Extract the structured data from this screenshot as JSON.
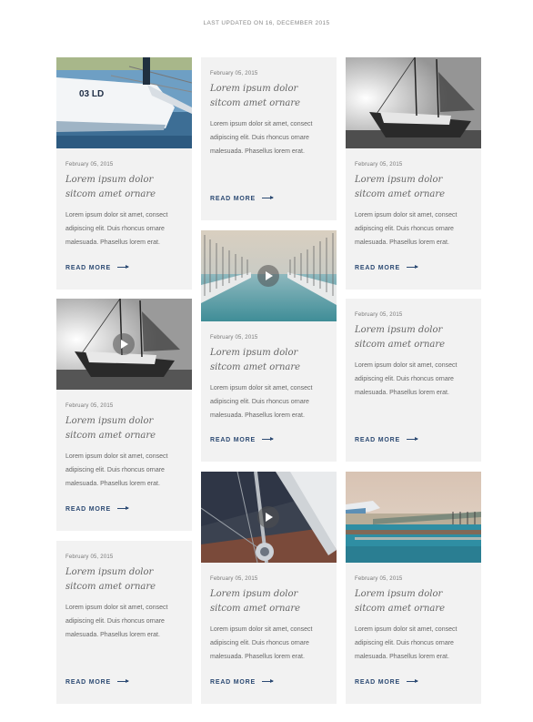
{
  "header": {
    "updated": "LAST UPDATED ON 16, DECEMBER 2015"
  },
  "posts": [
    {
      "date": "February 05, 2015",
      "title": "Lorem ipsum dolor sitcom amet ornare",
      "excerpt": "Lorem ipsum dolor sit amet, consect adipiscing elit. Duis rhoncus ornare malesuada. Phasellus lorem erat.",
      "more": "READ MORE",
      "image": "sailboat-stern-photo"
    },
    {
      "date": "February 05, 2015",
      "title": "Lorem ipsum dolor sitcom amet ornare",
      "excerpt": "Lorem ipsum dolor sit amet, consect adipiscing elit. Duis rhoncus ornare malesuada. Phasellus lorem erat.",
      "more": "READ MORE",
      "image": "sailboat-bw-video"
    },
    {
      "date": "February 05, 2015",
      "title": "Lorem ipsum dolor sitcom amet ornare",
      "excerpt": "Lorem ipsum dolor sit amet, consect adipiscing elit. Duis rhoncus ornare malesuada. Phasellus lorem erat.",
      "more": "READ MORE",
      "image": null
    },
    {
      "date": "February 05, 2015",
      "title": "Lorem ipsum dolor sitcom amet ornare",
      "excerpt": "Lorem ipsum dolor sit amet, consect adipiscing elit. Duis rhoncus ornare malesuada. Phasellus lorem erat.",
      "more": "READ MORE",
      "image": null
    },
    {
      "date": "February 05, 2015",
      "title": "Lorem ipsum dolor sitcom amet ornare",
      "excerpt": "Lorem ipsum dolor sit amet, consect adipiscing elit. Duis rhoncus ornare malesuada. Phasellus lorem erat.",
      "more": "READ MORE",
      "image": "marina-video"
    },
    {
      "date": "February 05, 2015",
      "title": "Lorem ipsum dolor sitcom amet ornare",
      "excerpt": "Lorem ipsum dolor sit amet, consect adipiscing elit. Duis rhoncus ornare malesuada. Phasellus lorem erat.",
      "more": "READ MORE",
      "image": "sail-mast-video"
    },
    {
      "date": "February 05, 2015",
      "title": "Lorem ipsum dolor sitcom amet ornare",
      "excerpt": "Lorem ipsum dolor sit amet, consect adipiscing elit. Duis rhoncus ornare malesuada. Phasellus lorem erat.",
      "more": "READ MORE",
      "image": "sailboat-bw-photo"
    },
    {
      "date": "February 05, 2015",
      "title": "Lorem ipsum dolor sitcom amet ornare",
      "excerpt": "Lorem ipsum dolor sit amet, consect adipiscing elit. Duis rhoncus ornare malesuada. Phasellus lorem erat.",
      "more": "READ MORE",
      "image": null
    },
    {
      "date": "February 05, 2015",
      "title": "Lorem ipsum dolor sitcom amet ornare",
      "excerpt": "Lorem ipsum dolor sit amet, consect adipiscing elit. Duis rhoncus ornare malesuada. Phasellus lorem erat.",
      "more": "READ MORE",
      "image": "harbor-photo"
    }
  ]
}
